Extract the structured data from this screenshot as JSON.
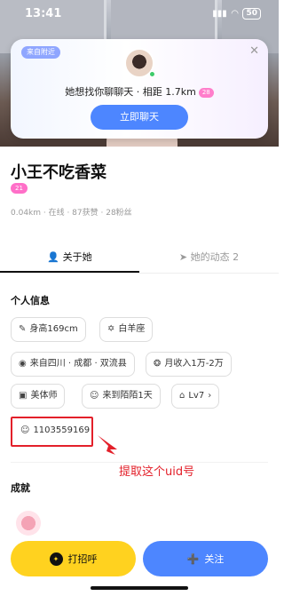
{
  "status_bar": {
    "time": "13:41",
    "battery": "50"
  },
  "popup": {
    "tag": "来自附近",
    "message": "她想找你聊聊天 · 相距 1.7km",
    "level": "28",
    "chat_button": "立即聊天"
  },
  "profile": {
    "name": "小王不吃香菜",
    "level": "21",
    "meta": "0.04km · 在线 · 87获赞 · 28粉丝"
  },
  "tabs": [
    {
      "label": "关于她"
    },
    {
      "label": "她的动态 2"
    }
  ],
  "section_personal": "个人信息",
  "chips": [
    {
      "icon": "ruler-icon",
      "label": "身高169cm"
    },
    {
      "icon": "zodiac-icon",
      "label": "白羊座"
    },
    {
      "icon": "location-icon",
      "label": "来自四川 · 成都 · 双流县"
    },
    {
      "icon": "money-bag-icon",
      "label": "月收入1万-2万"
    },
    {
      "icon": "briefcase-icon",
      "label": "美体师"
    },
    {
      "icon": "user-icon",
      "label": "来到陌陌1天"
    },
    {
      "icon": "badge-icon",
      "label": "Lv7"
    },
    {
      "icon": "user-icon",
      "label": "1103559169"
    }
  ],
  "annotation": "提取这个uid号",
  "section_achievements": "成就",
  "bottom": {
    "greet": "打招呼",
    "follow": "关注"
  },
  "colors": {
    "accent": "#4d86ff",
    "yellow": "#ffd21f",
    "annotation_red": "#e3202a"
  }
}
